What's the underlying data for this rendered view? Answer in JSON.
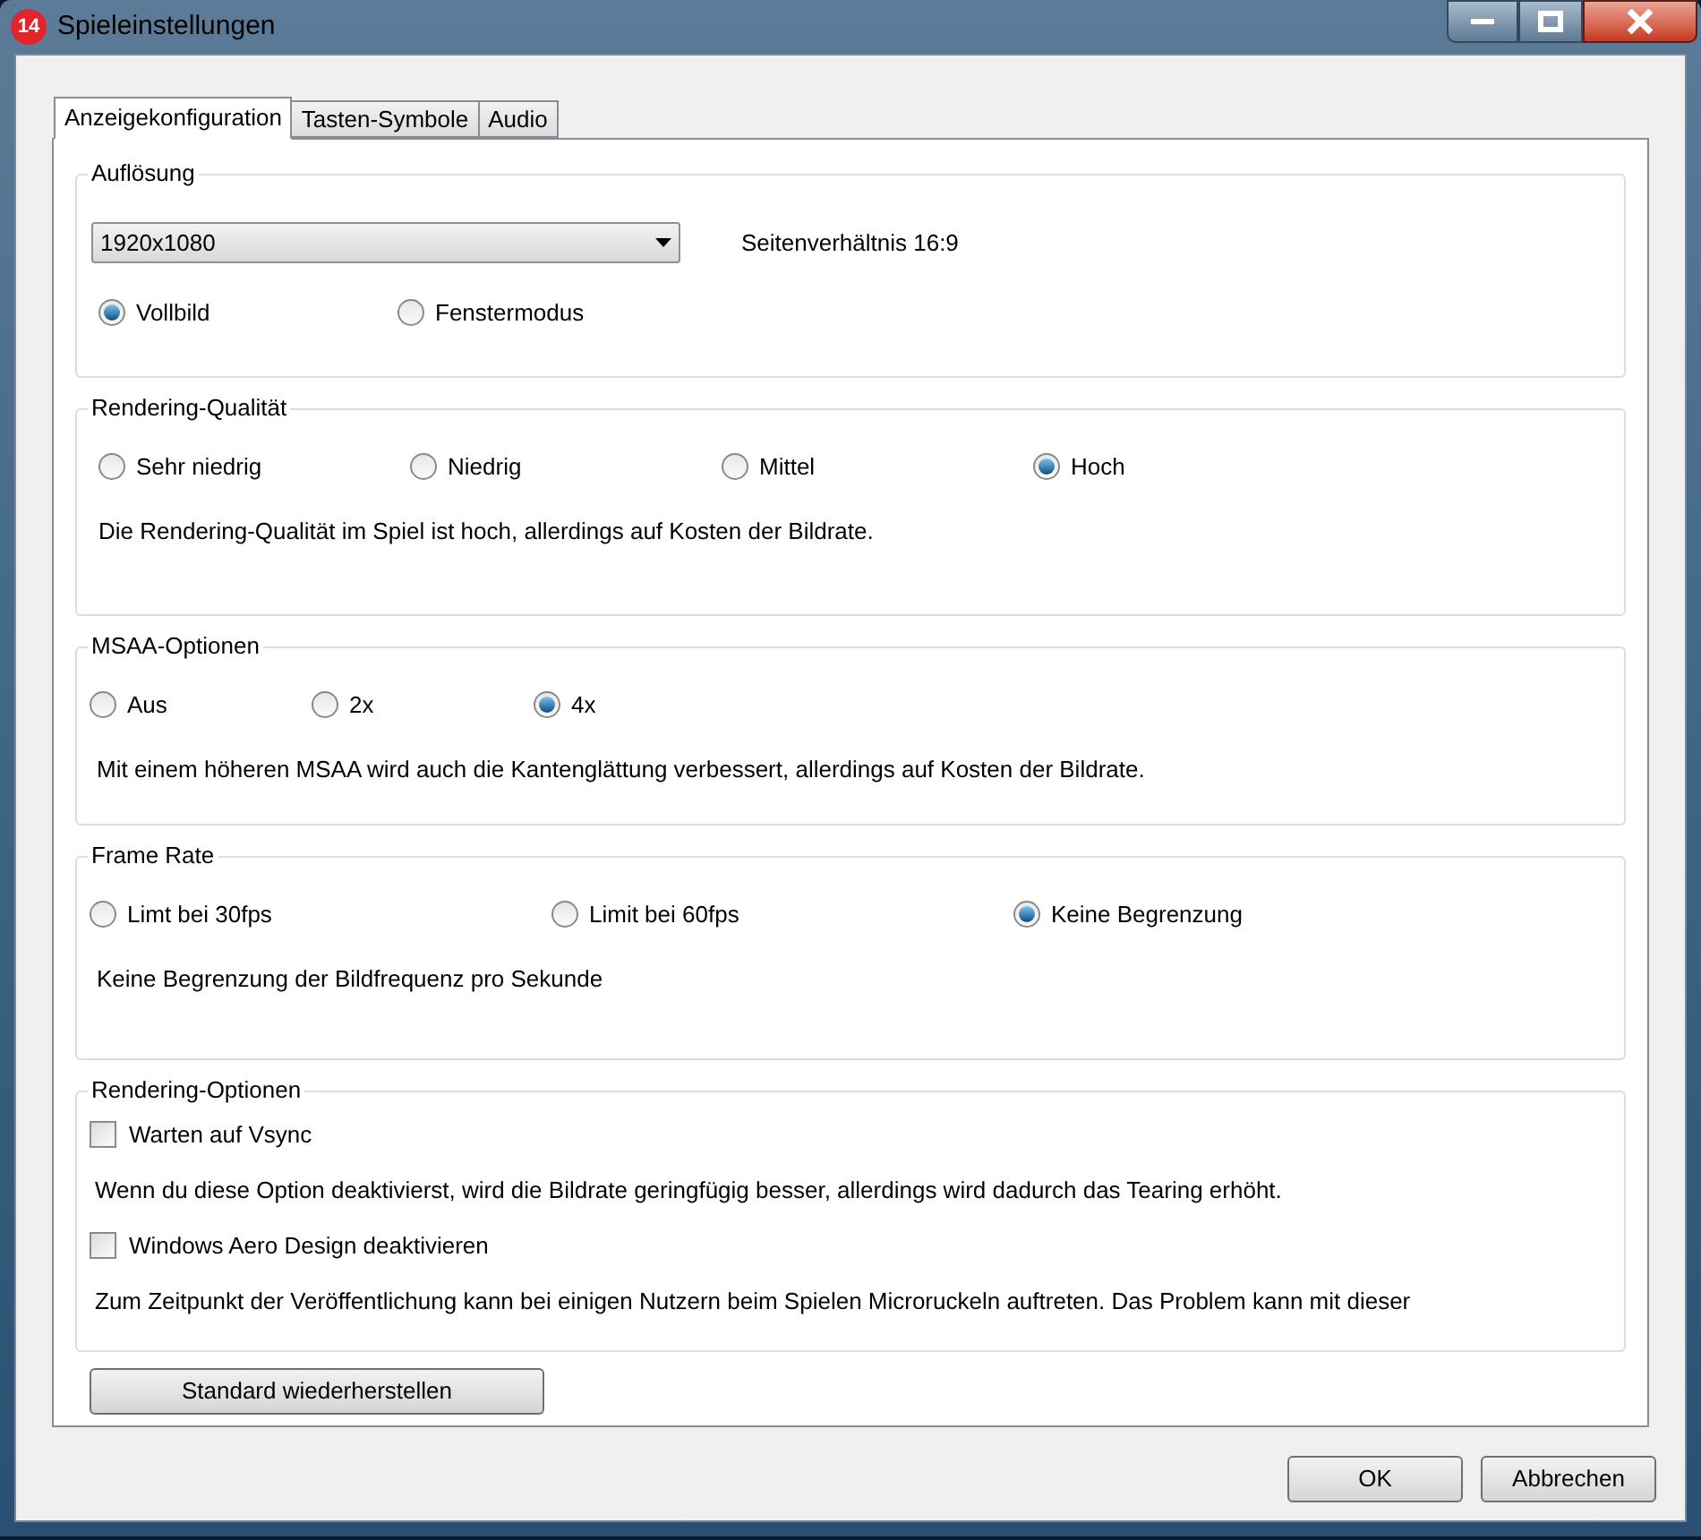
{
  "window": {
    "title": "Spieleinstellungen",
    "app_badge": "14"
  },
  "tabs": [
    {
      "label": "Anzeigekonfiguration",
      "selected": true
    },
    {
      "label": "Tasten-Symbole",
      "selected": false
    },
    {
      "label": "Audio",
      "selected": false
    }
  ],
  "sections": [
    {
      "kind": "resolution",
      "title": "Auflösung",
      "dropdown": {
        "value": "1920x1080"
      },
      "aspect_ratio": "Seitenverhältnis 16:9",
      "options": [
        {
          "label": "Vollbild",
          "selected": true
        },
        {
          "label": "Fenstermodus",
          "selected": false
        }
      ]
    },
    {
      "kind": "radio",
      "title": "Rendering-Qualität",
      "options": [
        {
          "label": "Sehr niedrig",
          "selected": false
        },
        {
          "label": "Niedrig",
          "selected": false
        },
        {
          "label": "Mittel",
          "selected": false
        },
        {
          "label": "Hoch",
          "selected": true
        }
      ],
      "description": "Die Rendering-Qualität im Spiel ist hoch, allerdings auf Kosten der Bildrate."
    },
    {
      "kind": "radio",
      "title": "MSAA-Optionen",
      "options": [
        {
          "label": "Aus",
          "selected": false
        },
        {
          "label": "2x",
          "selected": false
        },
        {
          "label": "4x",
          "selected": true
        }
      ],
      "description": "Mit einem höheren MSAA wird auch die Kantenglättung verbessert, allerdings auf Kosten der Bildrate."
    },
    {
      "kind": "radio",
      "title": "Frame Rate",
      "options": [
        {
          "label": "Limt bei 30fps",
          "selected": false
        },
        {
          "label": "Limit bei 60fps",
          "selected": false
        },
        {
          "label": "Keine Begrenzung",
          "selected": true
        }
      ],
      "description": "Keine Begrenzung der Bildfrequenz pro Sekunde"
    },
    {
      "kind": "checks",
      "title": "Rendering-Optionen",
      "checks": [
        {
          "label": "Warten auf Vsync",
          "checked": false,
          "description": "Wenn du diese Option deaktivierst, wird die Bildrate geringfügig besser, allerdings wird dadurch das Tearing erhöht."
        },
        {
          "label": "Windows Aero Design deaktivieren",
          "checked": false,
          "description": "Zum Zeitpunkt der Veröffentlichung kann bei einigen Nutzern beim Spielen Microruckeln auftreten. Das Problem kann mit dieser"
        }
      ]
    }
  ],
  "reset_button": "Standard wiederherstellen",
  "buttons": [
    "OK",
    "Abbrechen"
  ]
}
